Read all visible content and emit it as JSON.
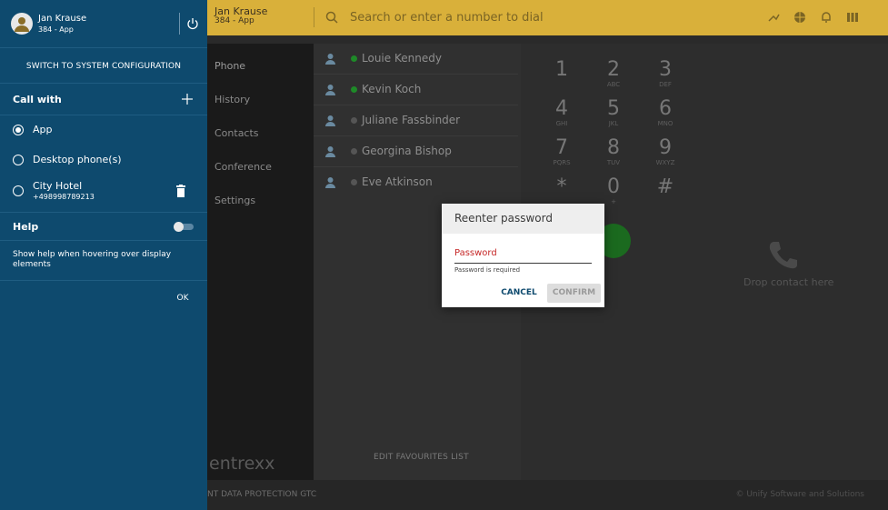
{
  "topbar": {
    "user_name": "Jan Krause",
    "user_sub": "384 - App",
    "search_placeholder": "Search or enter a number to dial",
    "icons": [
      "search-icon",
      "call-forward-icon",
      "globe-icon",
      "bell-icon",
      "grid-icon"
    ]
  },
  "nav": {
    "items": [
      "Phone",
      "History",
      "Contacts",
      "Conference",
      "Settings"
    ],
    "logo_text": "entrexx"
  },
  "contacts": [
    {
      "name": "Louie Kennedy",
      "status": "online"
    },
    {
      "name": "Kevin Koch",
      "status": "online"
    },
    {
      "name": "Juliane Fassbinder",
      "status": "offline"
    },
    {
      "name": "Georgina Bishop",
      "status": "offline"
    },
    {
      "name": "Eve Atkinson",
      "status": "offline"
    }
  ],
  "dialpad": {
    "keys": [
      {
        "digit": "1",
        "letters": ""
      },
      {
        "digit": "2",
        "letters": "ABC"
      },
      {
        "digit": "3",
        "letters": "DEF"
      },
      {
        "digit": "4",
        "letters": "GHI"
      },
      {
        "digit": "5",
        "letters": "JKL"
      },
      {
        "digit": "6",
        "letters": "MNO"
      },
      {
        "digit": "7",
        "letters": "PQRS"
      },
      {
        "digit": "8",
        "letters": "TUV"
      },
      {
        "digit": "9",
        "letters": "WXYZ"
      },
      {
        "digit": "*",
        "letters": ""
      },
      {
        "digit": "0",
        "letters": "+"
      },
      {
        "digit": "#",
        "letters": ""
      }
    ],
    "drop_text": "Drop contact here"
  },
  "edit_favourites": "EDIT FAVOURITES LIST",
  "footer": {
    "links": "NT   DATA PROTECTION   GTC",
    "copyright": "© Unify Software and Solutions"
  },
  "drawer": {
    "user_name": "Jan Krause",
    "user_sub": "384 - App",
    "switch_label": "SWITCH TO SYSTEM CONFIGURATION",
    "call_with_title": "Call with",
    "options": [
      {
        "label": "App",
        "sub": "",
        "checked": true
      },
      {
        "label": "Desktop phone(s)",
        "sub": "",
        "checked": false
      },
      {
        "label": "City Hotel",
        "sub": "+498998789213",
        "checked": false
      }
    ],
    "help_title": "Help",
    "help_enabled": false,
    "help_description": "Show help when hovering over display elements",
    "ok_label": "OK"
  },
  "dialog": {
    "title": "Reenter password",
    "field_label": "Password",
    "field_value": "",
    "hint": "Password is required",
    "cancel_label": "CANCEL",
    "confirm_label": "CONFIRM"
  },
  "colors": {
    "drawer_bg": "#0e4a6e",
    "topbar_bg": "#d9b03a",
    "error_red": "#c62828",
    "online_green": "#1e8a28"
  }
}
